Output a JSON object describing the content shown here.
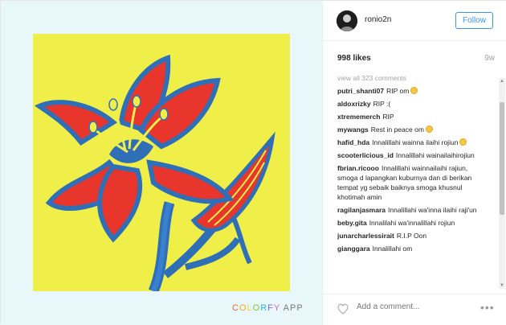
{
  "media": {
    "brand": {
      "letters": [
        "C",
        "O",
        "L",
        "O",
        "R",
        "F",
        "Y"
      ],
      "letter_colors": [
        "#f0633f",
        "#f5a623",
        "#f5d033",
        "#7ac943",
        "#33b5e5",
        "#7b68ee",
        "#d45fd1"
      ],
      "suffix": " APP",
      "suffix_color": "#7a7a7a"
    },
    "colors": {
      "background": "#f0ef4a",
      "petal": "#e8362c",
      "outline": "#2f6fb8",
      "stamen": "#f0ef4a"
    }
  },
  "post": {
    "username": "ronio2n",
    "follow_label": "Follow",
    "likes": "998 likes",
    "age": "9w",
    "view_all": "view all 323 comments",
    "comments": [
      {
        "user": "putri_shanti07",
        "text": "RIP om",
        "emoji": true
      },
      {
        "user": "aldoxrizky",
        "text": "RIP :(",
        "emoji": false
      },
      {
        "user": "xtrememerch",
        "text": "RIP",
        "emoji": false
      },
      {
        "user": "mywangs",
        "text": "Rest in peace om",
        "emoji": true
      },
      {
        "user": "hafid_hda",
        "text": "Innalillahi wainna ilaihi rojiun",
        "emoji": true
      },
      {
        "user": "scooterlicious_id",
        "text": "Innalillahi wainailaihirojiun",
        "emoji": false
      },
      {
        "user": "fbrian.ricooo",
        "text": "Innalillahi wainnailaihi rajiun, smoga d lapangkan kuburnya dan di berikan tempat yg sebaik baiknya smoga khusnul khotimah amin",
        "emoji": false
      },
      {
        "user": "ragilanjasmara",
        "text": "Innalillahi wa'inna ilaihi raji'un",
        "emoji": false
      },
      {
        "user": "beby.gita",
        "text": "Innalilahi wa'innalillahi rojiun",
        "emoji": false
      },
      {
        "user": "junarcharlessirait",
        "text": "R.I.P Oon",
        "emoji": false
      },
      {
        "user": "gianggara",
        "text": "Innalillahi om",
        "emoji": false
      }
    ],
    "add_comment_placeholder": "Add a comment...",
    "more_label": "•••"
  },
  "icons": {
    "heart": "heart-icon",
    "more": "more-options-icon",
    "avatar": "avatar"
  }
}
